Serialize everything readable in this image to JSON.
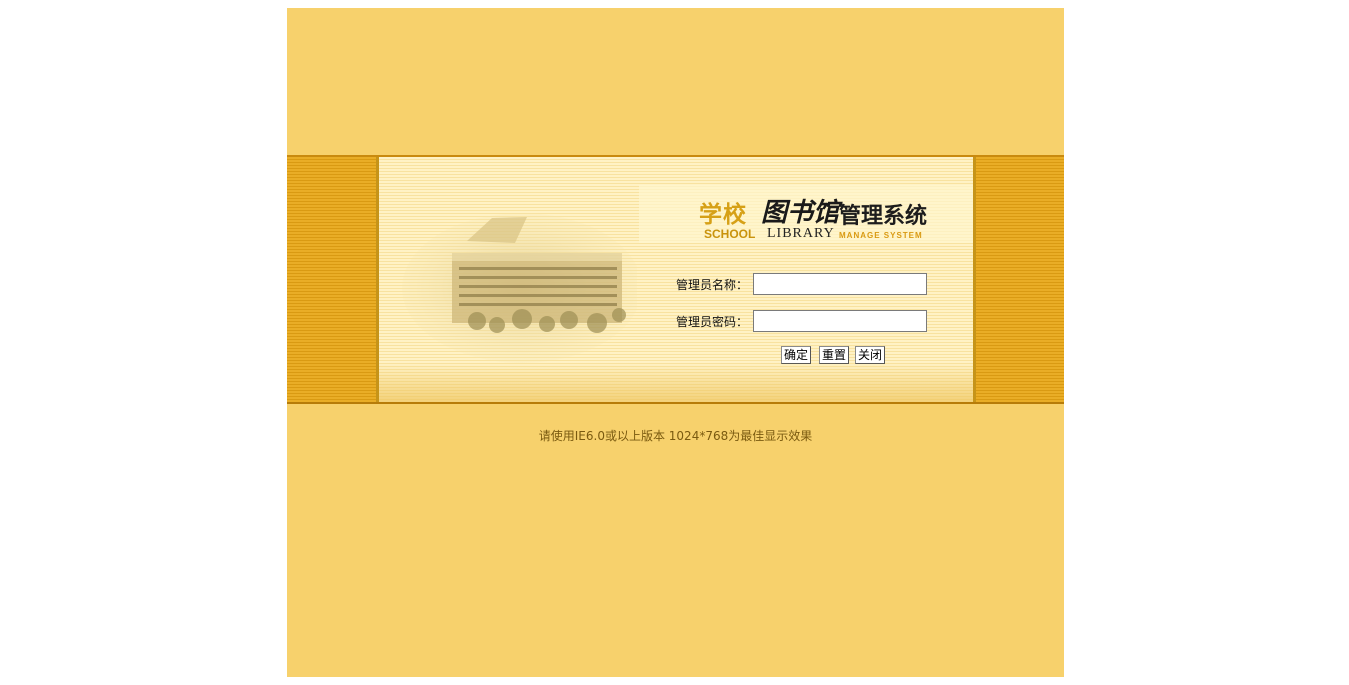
{
  "title": {
    "school_cn": "学校",
    "school_en": "SCHOOL",
    "library_cn": "图书馆",
    "library_en": "LIBRARY",
    "manage_cn": "管理系统",
    "manage_en": "MANAGE SYSTEM"
  },
  "form": {
    "username_label": "管理员名称：",
    "username_value": "",
    "password_label": "管理员密码：",
    "password_value": "",
    "confirm_button": "确定",
    "reset_button": "重置",
    "close_button": "关闭"
  },
  "notice": "请使用IE6.0或以上版本 1024*768为最佳显示效果",
  "colors": {
    "page_background": "#f7d16c",
    "band": "#e9ad26",
    "accent_gold": "#d6a016"
  }
}
